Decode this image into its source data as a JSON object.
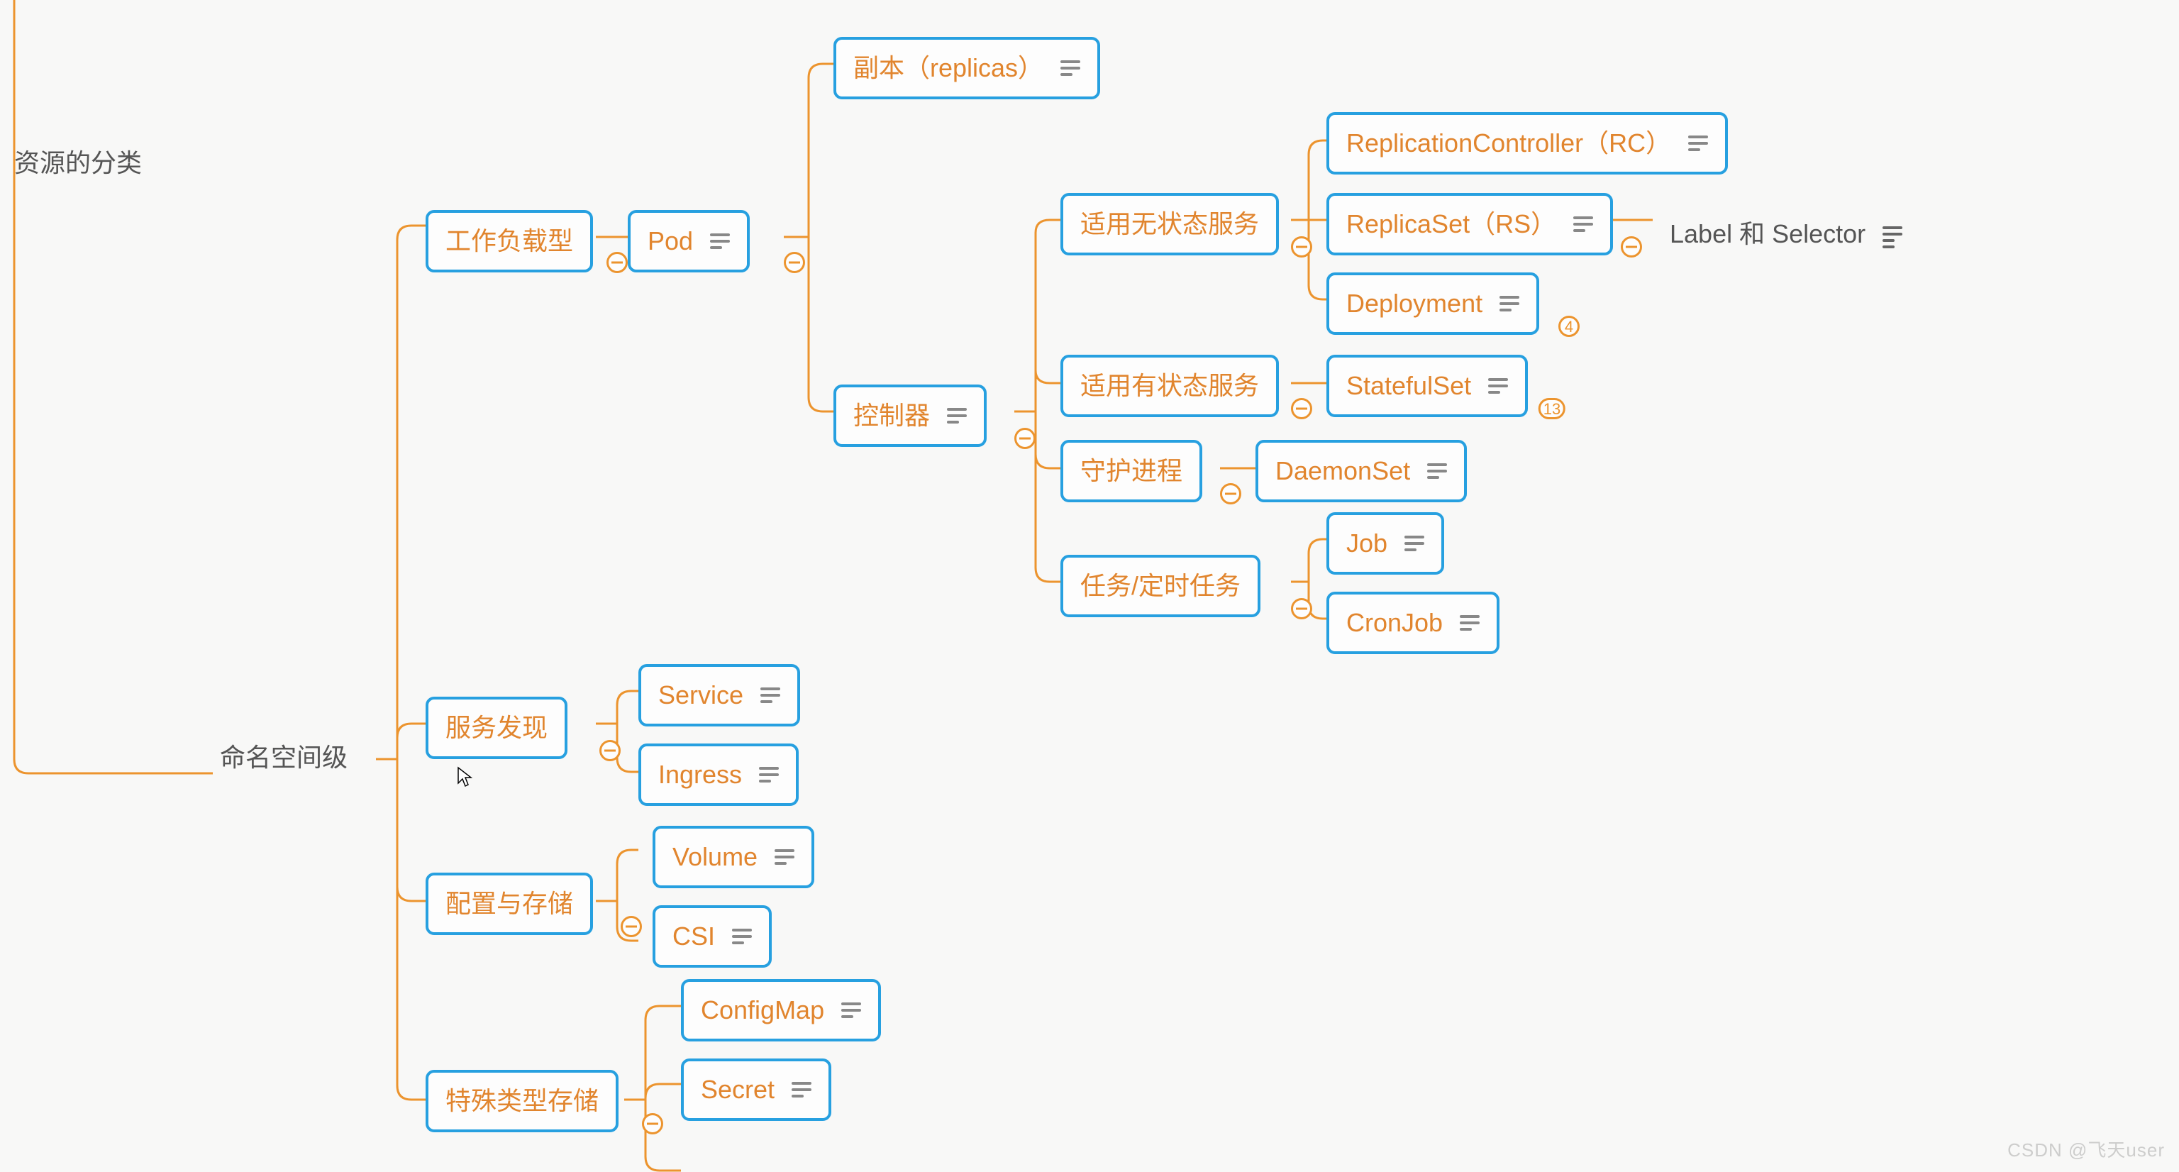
{
  "rootUnboxed": "资源的分类",
  "level1": "命名空间级",
  "branches": {
    "workload": {
      "label": "工作负载型"
    },
    "discovery": {
      "label": "服务发现"
    },
    "storage": {
      "label": "配置与存储"
    },
    "special": {
      "label": "特殊类型存储"
    }
  },
  "pod": {
    "label": "Pod"
  },
  "podChildren": {
    "replicas": {
      "label": "副本（replicas）"
    },
    "controller": {
      "label": "控制器"
    }
  },
  "controllerChildren": {
    "stateless": {
      "label": "适用无状态服务"
    },
    "stateful": {
      "label": "适用有状态服务"
    },
    "daemon": {
      "label": "守护进程"
    },
    "jobs": {
      "label": "任务/定时任务"
    }
  },
  "statelessChildren": {
    "rc": {
      "label": "ReplicationController（RC）"
    },
    "rs": {
      "label": "ReplicaSet（RS）"
    },
    "deploy": {
      "label": "Deployment"
    }
  },
  "statefulChildren": {
    "sts": {
      "label": "StatefulSet"
    }
  },
  "daemonChildren": {
    "ds": {
      "label": "DaemonSet"
    }
  },
  "jobChildren": {
    "job": {
      "label": "Job"
    },
    "cron": {
      "label": "CronJob"
    }
  },
  "rsChild": {
    "label": "Label 和 Selector"
  },
  "discoveryChildren": {
    "service": {
      "label": "Service"
    },
    "ingress": {
      "label": "Ingress"
    }
  },
  "storageChildren": {
    "volume": {
      "label": "Volume"
    },
    "csi": {
      "label": "CSI"
    }
  },
  "specialChildren": {
    "cm": {
      "label": "ConfigMap"
    },
    "secret": {
      "label": "Secret"
    }
  },
  "badges": {
    "deploy": "4",
    "sts": "13"
  },
  "watermark": "CSDN @飞天user"
}
